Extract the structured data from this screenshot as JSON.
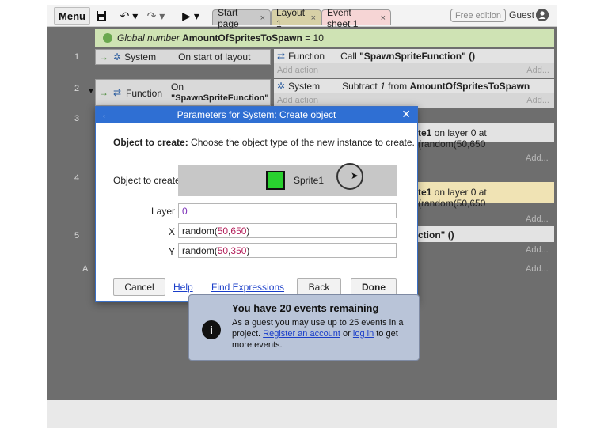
{
  "toolbar": {
    "menu_label": "Menu",
    "save_icon": "save-icon",
    "undo_icon": "↶ ▾",
    "redo_icon": "↷ ▾",
    "play_icon": "▶ ▾"
  },
  "tabs": [
    {
      "label": "Start page",
      "close": "×"
    },
    {
      "label": "Layout 1",
      "close": "×"
    },
    {
      "label": "Event sheet 1",
      "close": "×"
    }
  ],
  "edition_badge": "Free edition",
  "guest_label": "Guest",
  "global_variable": {
    "keyword": "Global number",
    "name": "AmountOfSpritesToSpawn",
    "value": "= 10"
  },
  "events": [
    {
      "number": "1",
      "condition_object": "System",
      "condition_text": "On start of layout",
      "action_object": "Function",
      "action_text_prefix": "Call",
      "action_text_value": "\"SpawnSpriteFunction\" ()",
      "add_action": "Add action",
      "add_right": "Add..."
    },
    {
      "number": "2",
      "condition_object": "Function",
      "condition_line1": "On",
      "condition_line2": "\"SpawnSpriteFunction\"",
      "action_object": "System",
      "action_text_prefix": "Subtract",
      "action_text_num": "1",
      "action_text_mid": "from",
      "action_text_value": "AmountOfSpritesToSpawn",
      "add_action": "Add action",
      "add_right": "Add..."
    }
  ],
  "background_rows": {
    "num3": "3",
    "num4": "4",
    "num5": "5",
    "row3_text_bold": "te1",
    "row3_text_rest": " on layer 0 at (random(50,650",
    "row4_text_bold": "te1",
    "row4_text_rest": " on layer 0 at (random(50,650",
    "row5_text": "ction\" ()",
    "add": "Add...",
    "left_a": "A"
  },
  "dialog": {
    "title": "Parameters for System: Create object",
    "desc_bold": "Object to create:",
    "desc_rest": " Choose the object type of the new instance to create.",
    "object_label": "Object to create",
    "sprite_name": "Sprite1",
    "layer_label": "Layer",
    "layer_value": "0",
    "x_label": "X",
    "x_value": {
      "fn": "random(",
      "a": "50",
      "comma": ",",
      "b": "650",
      "end": ")"
    },
    "y_label": "Y",
    "y_value": {
      "fn": "random(",
      "a": "50",
      "comma": ",",
      "b": "350",
      "end": ")"
    },
    "cancel": "Cancel",
    "help": "Help",
    "find_expressions": "Find Expressions",
    "back": "Back",
    "done": "Done"
  },
  "notice": {
    "title": "You have 20 events remaining",
    "line1": "As a guest you may use up to 25 events in a",
    "line2_prefix": "project. ",
    "register_link": "Register an account",
    "or": " or ",
    "login_link": "log in",
    "line2_suffix": " to get",
    "line3": "more events."
  },
  "colors": {
    "accent": "#2f6fd3",
    "global_row": "#cfe3b4",
    "sprite_green": "#29d12f"
  }
}
